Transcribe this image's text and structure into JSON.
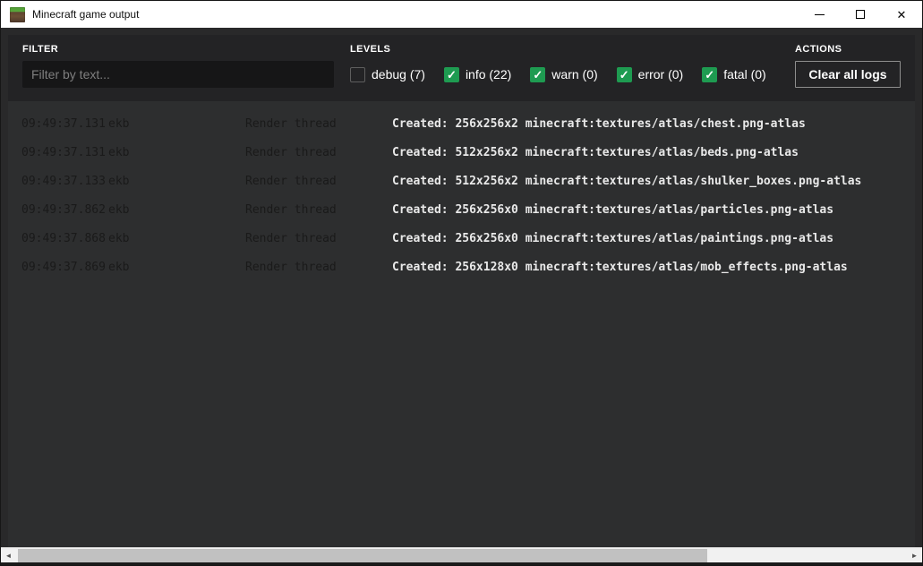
{
  "window": {
    "title": "Minecraft game output"
  },
  "filter": {
    "label": "FILTER",
    "placeholder": "Filter by text...",
    "value": ""
  },
  "levels": {
    "label": "LEVELS",
    "items": [
      {
        "id": "debug",
        "label": "debug (7)",
        "checked": false
      },
      {
        "id": "info",
        "label": "info (22)",
        "checked": true
      },
      {
        "id": "warn",
        "label": "warn (0)",
        "checked": true
      },
      {
        "id": "error",
        "label": "error (0)",
        "checked": true
      },
      {
        "id": "fatal",
        "label": "fatal (0)",
        "checked": true
      }
    ]
  },
  "actions": {
    "label": "ACTIONS",
    "clear_button": "Clear all logs"
  },
  "logs": {
    "rows": [
      {
        "time": "09:49:37.131",
        "logger": "ekb",
        "thread": "Render thread",
        "message": "Created: 256x256x2 minecraft:textures/atlas/chest.png-atlas"
      },
      {
        "time": "09:49:37.131",
        "logger": "ekb",
        "thread": "Render thread",
        "message": "Created: 512x256x2 minecraft:textures/atlas/beds.png-atlas"
      },
      {
        "time": "09:49:37.133",
        "logger": "ekb",
        "thread": "Render thread",
        "message": "Created: 512x256x2 minecraft:textures/atlas/shulker_boxes.png-atlas"
      },
      {
        "time": "09:49:37.862",
        "logger": "ekb",
        "thread": "Render thread",
        "message": "Created: 256x256x0 minecraft:textures/atlas/particles.png-atlas"
      },
      {
        "time": "09:49:37.868",
        "logger": "ekb",
        "thread": "Render thread",
        "message": "Created: 256x256x0 minecraft:textures/atlas/paintings.png-atlas"
      },
      {
        "time": "09:49:37.869",
        "logger": "ekb",
        "thread": "Render thread",
        "message": "Created: 256x128x0 minecraft:textures/atlas/mob_effects.png-atlas"
      }
    ]
  },
  "colors": {
    "accent_green": "#1e9b51",
    "titlebar_bg": "#ffffff",
    "header_panel_bg": "#232325",
    "log_bg": "#2d2e2f"
  },
  "icons": {
    "check": "✓",
    "scroll_left": "◄",
    "scroll_right": "►",
    "close": "✕"
  }
}
